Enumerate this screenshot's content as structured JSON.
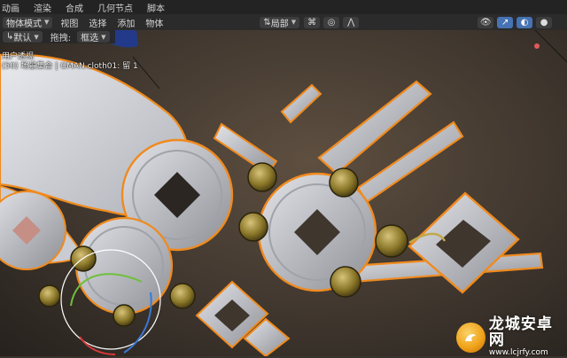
{
  "topbar": {
    "tabs": [
      "动画",
      "渲染",
      "合成",
      "几何节点",
      "脚本"
    ]
  },
  "header": {
    "mode_dropdown": "物体模式",
    "menus": [
      "视图",
      "选择",
      "添加",
      "物体"
    ],
    "pivot_dropdown": "局部"
  },
  "subheader": {
    "orientation_dropdown": "默认",
    "drag_label": "拖拽:",
    "drag_dropdown": "框选"
  },
  "viewport": {
    "view_name": "用户透视",
    "object_info": "(50) 场景集合 | GMAN.cloth01: 留 1"
  },
  "watermark": {
    "title": "龙城安卓网",
    "url": "www.lcjrfy.com"
  },
  "colors": {
    "selection_outline": "#f08a1e",
    "accent": "#4772b3",
    "background_top": "#4a3f35",
    "background_bottom": "#2b2622"
  },
  "icons": [
    "gizmo-icon",
    "overlay-icon",
    "shading-icon",
    "snap-icon",
    "proportional-icon",
    "transform-gizmo-icon"
  ]
}
